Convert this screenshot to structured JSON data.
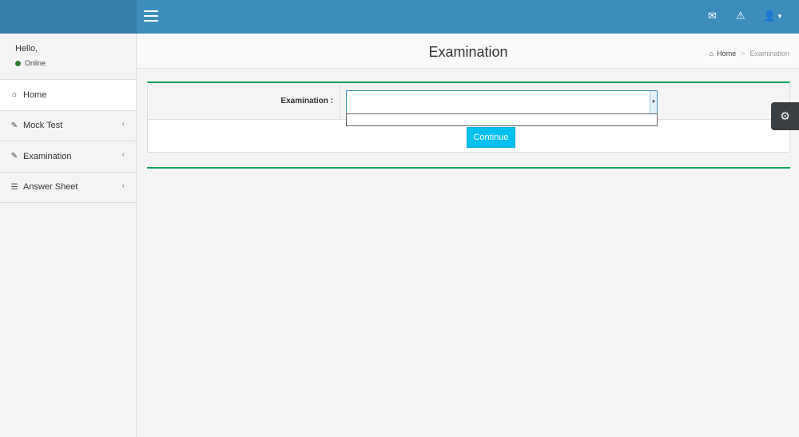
{
  "topbar": {
    "menu_icon": "hamburger-icon",
    "icons": [
      "envelope-icon",
      "warning-icon",
      "user-icon",
      "caret-down-icon"
    ]
  },
  "sidebar": {
    "greeting": "Hello,",
    "status": "Online",
    "items": [
      {
        "label": "Home",
        "icon": "home-icon"
      },
      {
        "label": "Mock Test",
        "icon": "edit-icon"
      },
      {
        "label": "Examination",
        "icon": "edit-icon"
      },
      {
        "label": "Answer Sheet",
        "icon": "list-icon"
      }
    ]
  },
  "header": {
    "title": "Examination",
    "breadcrumb": {
      "home": "Home",
      "separator": ">",
      "current": "Examination"
    }
  },
  "form": {
    "label": "Examination :",
    "select_value": "",
    "button": "Continue"
  },
  "colors": {
    "topbar": "#3c8dbc",
    "accent_green": "#00a65a",
    "button": "#00c0ef"
  }
}
